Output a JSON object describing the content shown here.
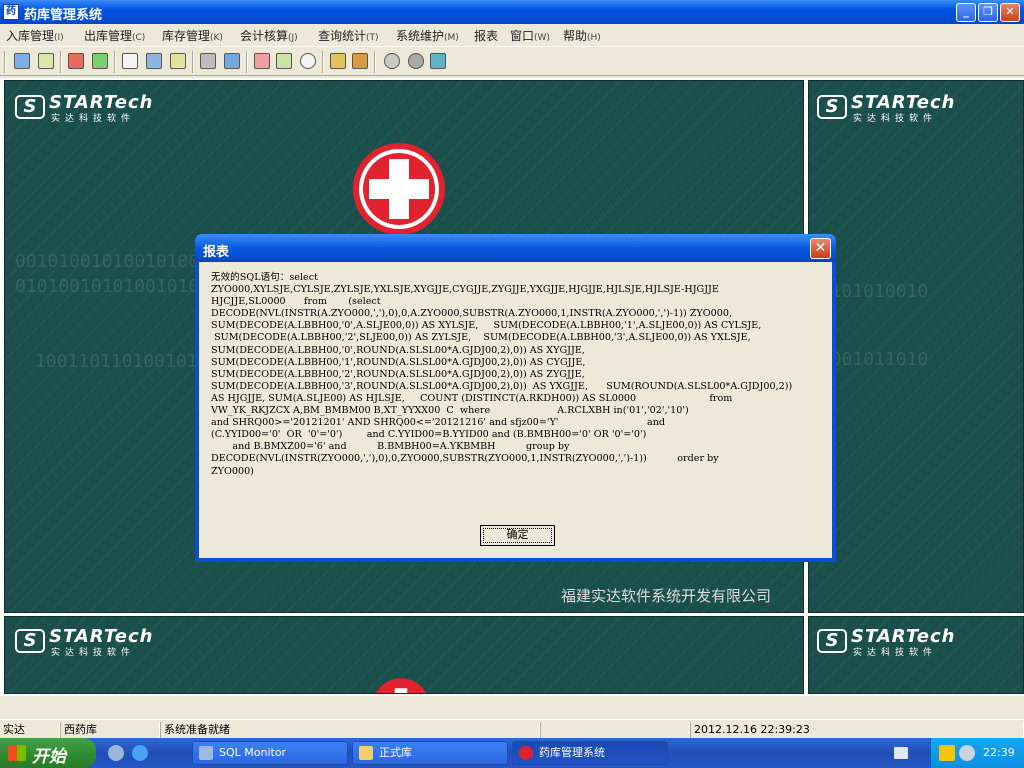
{
  "window": {
    "title": "药库管理系统",
    "app_icon": "药"
  },
  "menu": [
    {
      "label": "入库管理",
      "hotkey": "(I)"
    },
    {
      "label": "出库管理",
      "hotkey": "(C)"
    },
    {
      "label": "库存管理",
      "hotkey": "(K)"
    },
    {
      "label": "会计核算",
      "hotkey": "(J)"
    },
    {
      "label": "查询统计",
      "hotkey": "(T)"
    },
    {
      "label": "系统维护",
      "hotkey": "(M)"
    },
    {
      "label": "报表",
      "hotkey": ""
    },
    {
      "label": "窗口",
      "hotkey": "(W)"
    },
    {
      "label": "帮助",
      "hotkey": "(H)"
    }
  ],
  "background": {
    "logo_brand": "STARTech",
    "logo_mark": "S",
    "logo_sub": "实达科技软件",
    "company": "福建实达软件系统开发有限公司"
  },
  "dialog": {
    "title": "报表",
    "message": "无效的SQL语句：select\nZYO000,XYLSJE,CYLSJE,ZYLSJE,YXLSJE,XYGJJE,CYGJJE,ZYGJJE,YXGJJE,HJGJJE,HJLSJE,HJLSJE-HJGJJE\nHJCJJE,SL0000      from       (select\nDECODE(NVL(INSTR(A.ZYO000,','),0),0,A.ZYO000,SUBSTR(A.ZYO000,1,INSTR(A.ZYO000,',')-1)) ZYO000,\nSUM(DECODE(A.LBBH00,'0',A.SLJE00,0)) AS XYLSJE,     SUM(DECODE(A.LBBH00,'1',A.SLJE00,0)) AS CYLSJE,\n SUM(DECODE(A.LBBH00,'2',SLJE00,0)) AS ZYLSJE,    SUM(DECODE(A.LBBH00,'3',A.SLJE00,0)) AS YXLSJE,\nSUM(DECODE(A.LBBH00,'0',ROUND(A.SLSL00*A.GJDJ00,2),0)) AS XYGJJE,\nSUM(DECODE(A.LBBH00,'1',ROUND(A.SLSL00*A.GJDJ00,2),0)) AS CYGJJE,\nSUM(DECODE(A.LBBH00,'2',ROUND(A.SLSL00*A.GJDJ00,2),0)) AS ZYGJJE,\nSUM(DECODE(A.LBBH00,'3',ROUND(A.SLSL00*A.GJDJ00,2),0))  AS YXGJJE,      SUM(ROUND(A.SLSL00*A.GJDJ00,2))\nAS HJGJJE, SUM(A.SLJE00) AS HJLSJE,     COUNT (DISTINCT(A.RKDH00)) AS SL0000                        from\nVW_YK_RKJZCX A,BM_BMBM00 B,XT_YYXX00  C  where                      A.RCLXBH in('01','02','10')\nand SHRQ00>='20121201' AND SHRQ00<='20121216' and sfjz00='Y'                             and\n(C.YYID00='0'  OR  '0'='0')        and C.YYID00=B.YYID00 and (B.BMBH00='0' OR '0'='0')\n       and B.BMXZ00='6' and          B.BMBH00=A.YKBMBH          group by\nDECODE(NVL(INSTR(ZYO000,','),0),0,ZYO000,SUBSTR(ZYO000,1,INSTR(ZYO000,',')-1))          order by\nZYO000)",
    "ok_label": "确定"
  },
  "statusbar": {
    "cell1": "实达",
    "cell2": "西药库",
    "cell3": "系统准备就绪",
    "datetime": "2012.12.16 22:39:23"
  },
  "taskbar": {
    "start_label": "开始",
    "tasks": [
      {
        "label": "SQL Monitor"
      },
      {
        "label": "正式库"
      },
      {
        "label": "药库管理系统"
      }
    ],
    "clock": "22:39"
  },
  "colors": {
    "panel_bg": "#1b4f4b",
    "titlebar": "#0054e3",
    "cross_red": "#e0232f"
  }
}
